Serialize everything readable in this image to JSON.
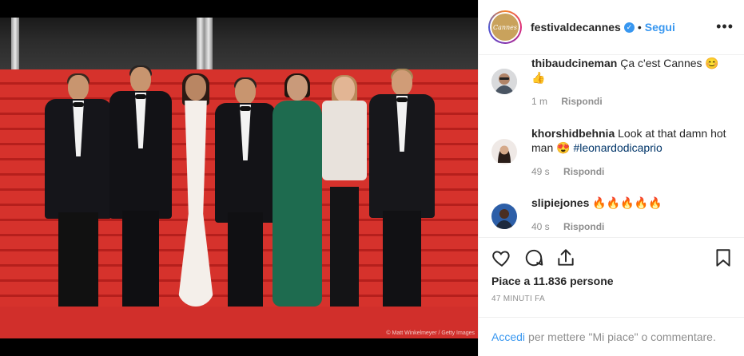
{
  "post": {
    "image_credit": "© Matt Winkelmeyer / Getty Images"
  },
  "header": {
    "username": "festivaldecannes",
    "verified_icon": "verified-badge-icon",
    "separator": "•",
    "follow_label": "Segui",
    "more_icon": "•••",
    "avatar_logo_text": "Cannes"
  },
  "comments": [
    {
      "username": "thibaudcineman",
      "text": "Ça c'est Cannes 😊👍",
      "time": "1 m",
      "reply_label": "Rispondi"
    },
    {
      "username": "khorshidbehnia",
      "text": "Look at that damn hot man 😍",
      "hashtag": "#leonardodicaprio",
      "time": "49 s",
      "reply_label": "Rispondi"
    },
    {
      "username": "slipiejones",
      "text": "🔥🔥🔥🔥🔥",
      "time": "40 s",
      "reply_label": "Rispondi"
    }
  ],
  "actions": {
    "like_icon": "heart-icon",
    "comment_icon": "comment-icon",
    "share_icon": "share-icon",
    "save_icon": "bookmark-icon"
  },
  "likes_text": "Piace a 11.836 persone",
  "time_ago": "47 MINUTI FA",
  "footer": {
    "login_label": "Accedi",
    "login_suffix": "per mettere \"Mi piace\" o commentare."
  },
  "colors": {
    "link_blue": "#3897f0",
    "carpet_red": "#d6322c",
    "muted": "#8e8e8e"
  }
}
